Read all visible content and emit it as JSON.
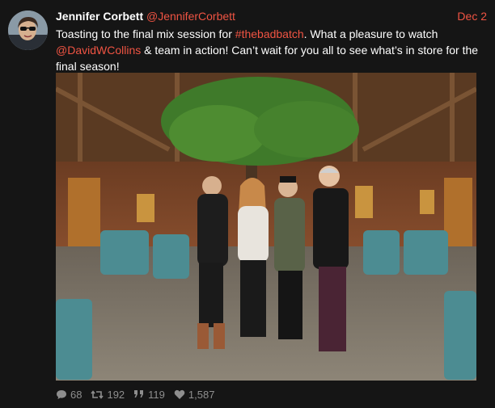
{
  "tweet": {
    "author_name": "Jennifer Corbett",
    "author_handle": "@JenniferCorbett",
    "date": "Dec 2",
    "text_part1": "Toasting to the final mix session for ",
    "hashtag": "#thebadbatch",
    "text_part2": ". What a pleasure to watch ",
    "mention": "@DavidWCollins",
    "text_part3": " & team in action! Can’t wait for you all to see what’s in store for the final season!"
  },
  "stats": {
    "replies": "68",
    "retweets": "192",
    "quotes": "119",
    "likes": "1,587"
  },
  "icons": {
    "reply": "comment-bubble-icon",
    "retweet": "retweet-icon",
    "quote": "quote-icon",
    "like": "heart-icon"
  },
  "colors": {
    "accent": "#f05443",
    "background": "#151515",
    "muted": "#8e8e8e"
  }
}
